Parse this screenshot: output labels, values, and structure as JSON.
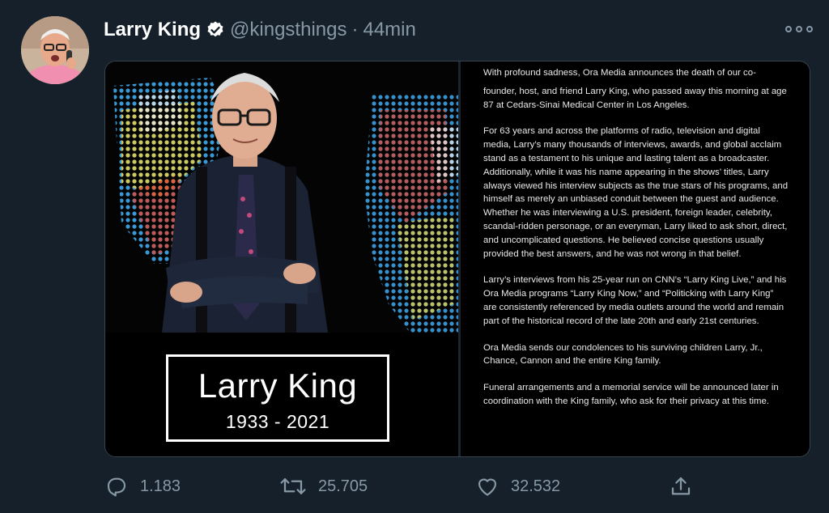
{
  "tweet": {
    "author_name": "Larry King",
    "handle": "@kingsthings",
    "separator": "·",
    "time": "44min",
    "verified": true,
    "avatar_icon": "avatar-photo"
  },
  "media": {
    "memorial_name": "Larry King",
    "memorial_years": "1933 - 2021",
    "statement": {
      "partial_line": "With profound sadness, Ora Media announces the death of our co-",
      "paragraphs": [
        "founder, host, and friend Larry King, who passed away this morning at age 87 at Cedars-Sinai Medical Center in Los Angeles.",
        "For 63 years and across the platforms of radio, television and digital media, Larry’s many thousands of interviews, awards, and global acclaim stand as a testament to his unique and lasting talent as a broadcaster. Additionally, while it was his name appearing in the shows’ titles, Larry always viewed his interview subjects as the true stars of his programs, and himself as merely an unbiased conduit between the guest and audience. Whether he was interviewing a U.S. president, foreign leader, celebrity, scandal-ridden personage, or an everyman, Larry liked to ask short, direct, and uncomplicated questions. He believed concise questions usually provided the best answers, and he was not wrong in that belief.",
        "Larry’s interviews from his 25-year run on CNN’s “Larry King Live,” and his Ora Media programs “Larry King Now,” and “Politicking with Larry King” are consistently referenced by media outlets around the world and remain part of the historical record of the late 20th and early 21st centuries.",
        "Ora Media sends our condolences to his surviving children Larry, Jr., Chance, Cannon and the entire King family.",
        "Funeral arrangements and a memorial service will be announced later in coordination with the King family, who ask for their privacy at this time."
      ]
    }
  },
  "actions": {
    "replies": "1.183",
    "retweets": "25.705",
    "likes": "32.532"
  },
  "colors": {
    "background": "#15202b",
    "secondary_text": "#8899a6",
    "border": "#38444d",
    "verified_badge": "#ffffff"
  }
}
